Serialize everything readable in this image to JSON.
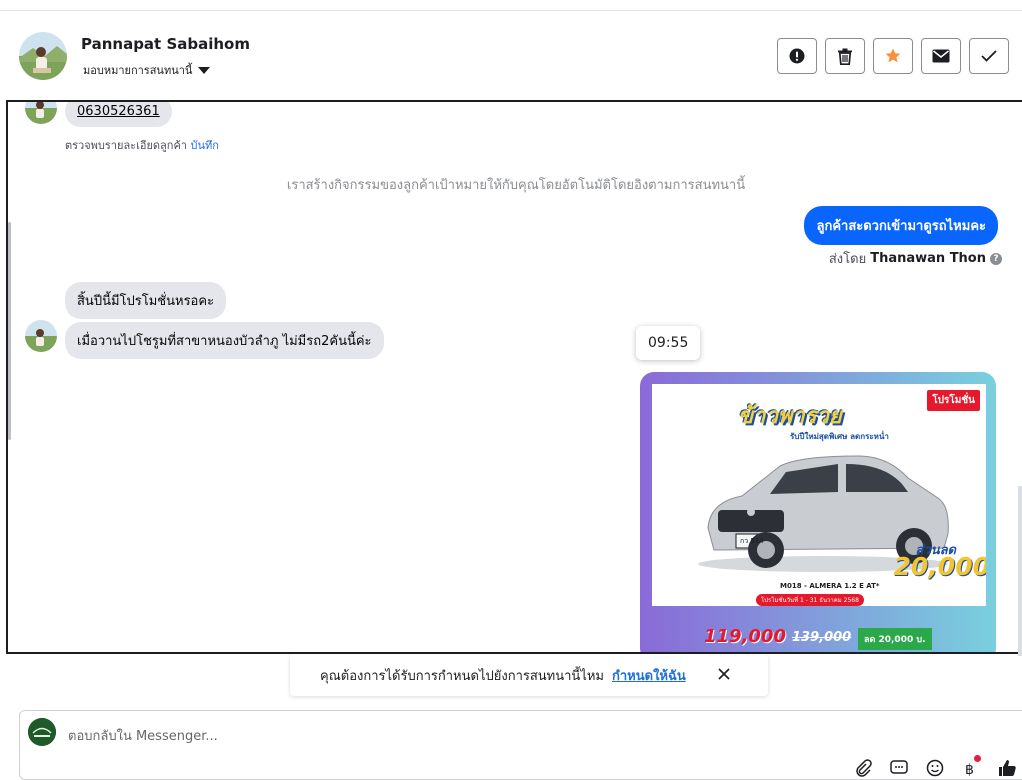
{
  "header": {
    "contact_name": "Pannapat Sabaihom",
    "assign_label": "มอบหมายการสนทนานี้",
    "actions": [
      {
        "name": "spam-button",
        "icon": "alert-icon"
      },
      {
        "name": "delete-button",
        "icon": "trash-icon"
      },
      {
        "name": "star-button",
        "icon": "star-icon"
      },
      {
        "name": "mark-unread-button",
        "icon": "envelope-icon"
      },
      {
        "name": "mark-done-button",
        "icon": "check-icon"
      }
    ]
  },
  "thread": {
    "phone_message": "0630526361",
    "details_note": "ตรวจพบรายละเอียดลูกค้า",
    "details_link": "บันทึก",
    "system_message": "เราสร้างกิจกรรมของลูกค้าเป้าหมายให้กับคุณโดยอัตโนมัติโดยอิงตามการสนทนานี้",
    "outgoing_message": "ลูกค้าสะดวกเข้ามาดูรถไหมคะ",
    "sent_by_prefix": "ส่งโดย",
    "sent_by_name": "Thanawan Thon",
    "incoming_1": "สิ้นปีนี้มีโปรโมชั่นหรอคะ",
    "incoming_2": "เมื่อวานไปโชรูมที่สาขาหนองบัวลำภู ไม่มีรถ2คันนี้ค่ะ",
    "tooltip_time": "09:55",
    "promo": {
      "tag": "โปรโมชั่น",
      "title": "ข้าวพารวย",
      "title_pre": "โปรโมชั่น",
      "subtitle": "รับปีใหม่สุดพิเศษ ลดกระหน่ำ",
      "discount_label": "ส่วนลด",
      "discount_value": "20,000",
      "model": "M018 - ALMERA 1.2 E AT*",
      "date_range": "โปรโมชั่นวันที่ 1 - 31 ธันวาคม 2568",
      "plate": "กว 514",
      "price": "119,000",
      "old_price": "139,000",
      "save": "ลด 20,000 บ."
    }
  },
  "banner": {
    "text": "คุณต้องการได้รับการกำหนดไปยังการสนทนานี้ไหม",
    "link": "กำหนดให้ฉัน"
  },
  "composer": {
    "placeholder": "ตอบกลับใน Messenger...",
    "icons": [
      "paperclip-icon",
      "saved-reply-icon",
      "emoji-icon",
      "payment-icon",
      "like-icon"
    ]
  },
  "colors": {
    "accent": "#0866ff",
    "star": "#f7923b",
    "link": "#216fdb"
  }
}
